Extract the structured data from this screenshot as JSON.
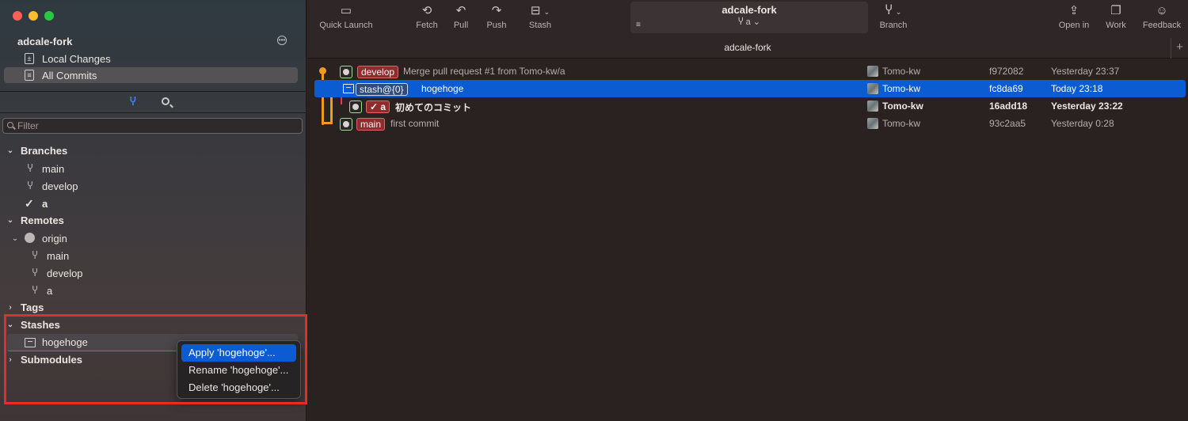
{
  "window": {
    "title": "adcale-fork",
    "tab_label": "adcale-fork",
    "tab_add": "+"
  },
  "toolbar": {
    "quick_launch": "Quick Launch",
    "fetch": "Fetch",
    "pull": "Pull",
    "push": "Push",
    "stash": "Stash",
    "repo_title": "adcale-fork",
    "current_branch": "a",
    "branch": "Branch",
    "open_in": "Open in",
    "work": "Work",
    "feedback": "Feedback"
  },
  "sidebar": {
    "repo_name": "adcale-fork",
    "nav": [
      {
        "label": "Local Changes"
      },
      {
        "label": "All Commits"
      }
    ],
    "filter_placeholder": "Filter",
    "sections": {
      "branches": "Branches",
      "remotes": "Remotes",
      "tags": "Tags",
      "stashes": "Stashes",
      "submodules": "Submodules"
    },
    "branches": [
      "main",
      "develop",
      "a"
    ],
    "remote_name": "origin",
    "remote_branches": [
      "main",
      "develop",
      "a"
    ],
    "stashes": [
      "hogehoge"
    ]
  },
  "context_menu": {
    "items": [
      "Apply 'hogehoge'...",
      "Rename 'hogehoge'...",
      "Delete 'hogehoge'..."
    ]
  },
  "commits": [
    {
      "badges": [
        "develop"
      ],
      "message": "Merge pull request #1 from Tomo-kw/a",
      "author": "Tomo-kw",
      "hash": "f972082",
      "date": "Yesterday 23:37"
    },
    {
      "badges": [
        "stash@{0}"
      ],
      "message": "hogehoge",
      "author": "Tomo-kw",
      "hash": "fc8da69",
      "date": "Today 23:18"
    },
    {
      "badges": [
        "a"
      ],
      "message": "初めてのコミット",
      "author": "Tomo-kw",
      "hash": "16add18",
      "date": "Yesterday 23:22"
    },
    {
      "badges": [
        "main"
      ],
      "message": "first commit",
      "author": "Tomo-kw",
      "hash": "93c2aa5",
      "date": "Yesterday 0:28"
    }
  ],
  "colors": {
    "accent": "#0b5bd3",
    "badge_red": "#8e2c2e",
    "graph": "#f29a1f",
    "highlight_box": "#e82b25"
  }
}
